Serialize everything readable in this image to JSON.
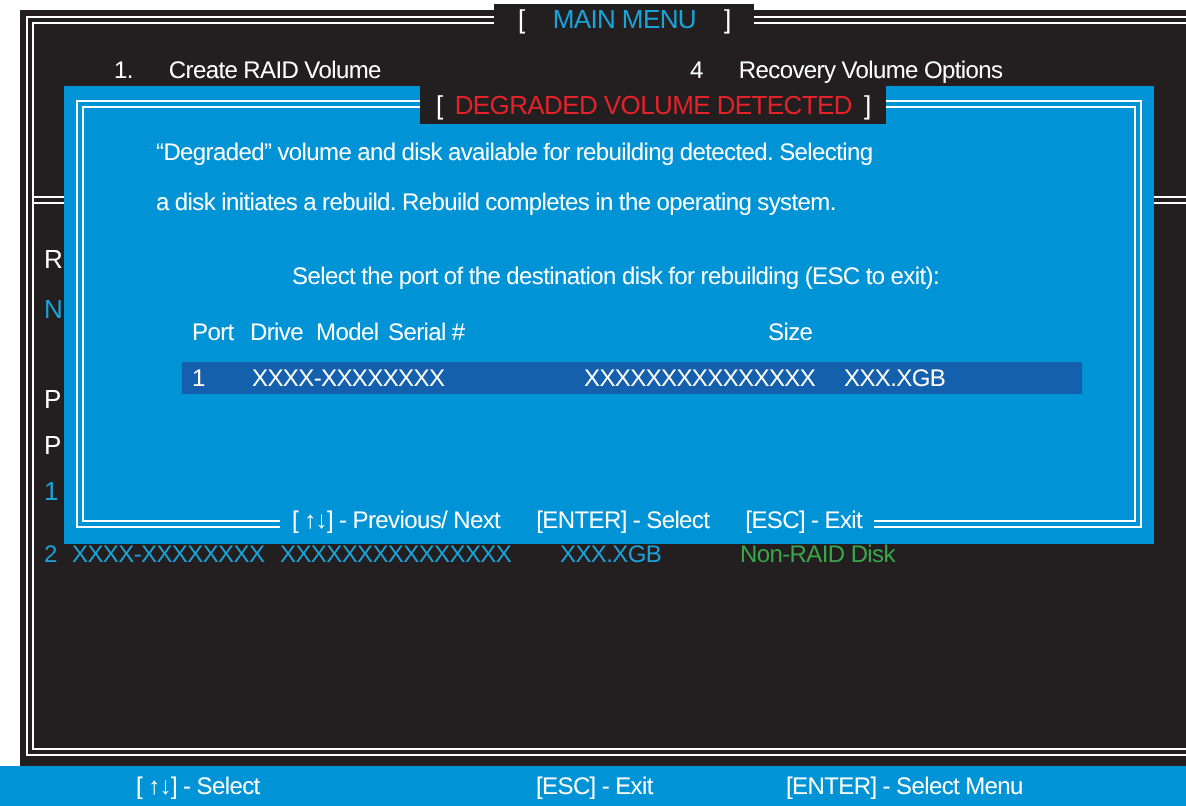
{
  "main_menu": {
    "title": "MAIN MENU",
    "brackets": [
      "[",
      "]"
    ],
    "options": [
      {
        "number": "1.",
        "label": "Create RAID Volume"
      },
      {
        "number": "4",
        "label": "Recovery Volume Options"
      }
    ],
    "partial_lines": [
      {
        "text": "R",
        "kind": "heading"
      },
      {
        "text": "N",
        "kind": "item"
      },
      {
        "text": "P",
        "kind": "heading"
      },
      {
        "text": "P",
        "kind": "heading"
      },
      {
        "text": "1",
        "kind": "item"
      }
    ],
    "disk_row": {
      "port": "2",
      "drive": "XXXX-XXXXXXXX",
      "serial": "XXXXXXXXXXXXXXX",
      "size": "XXX.XGB",
      "status": "Non-RAID Disk"
    }
  },
  "dialog": {
    "title": "DEGRADED VOLUME DETECTED",
    "brackets": [
      "[",
      "]"
    ],
    "message": [
      "“Degraded” volume and disk available for rebuilding detected. Selecting",
      "a disk initiates a rebuild. Rebuild completes in the  operating system."
    ],
    "prompt": "Select the port of the destination disk for rebuilding (ESC to exit):",
    "columns": [
      "Port",
      "Drive",
      "Model",
      "Serial #",
      "Size"
    ],
    "rows": [
      {
        "port": "1",
        "drive": "XXXX-XXXXXXXX",
        "serial": "XXXXXXXXXXXXXXX",
        "size": "XXX.XGB",
        "selected": true
      }
    ],
    "hints": [
      "[ ↑↓] - Previous/ Next",
      "[ENTER] - Select",
      "[ESC] - Exit"
    ]
  },
  "status_bar": [
    "[ ↑↓] - Select",
    "[ESC] - Exit",
    "[ENTER] - Select Menu"
  ]
}
